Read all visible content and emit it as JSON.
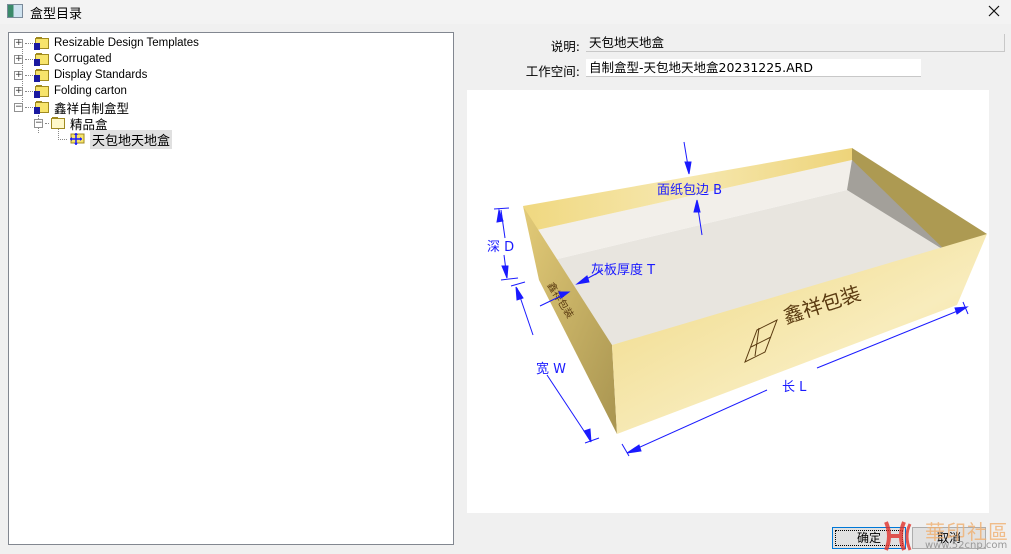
{
  "window": {
    "title": "盒型目录",
    "close_icon": "close-icon"
  },
  "tree": {
    "items": [
      {
        "label": "Resizable Design Templates",
        "expander": "+",
        "icon": "folder-icon"
      },
      {
        "label": "Corrugated",
        "expander": "+",
        "icon": "folder-icon"
      },
      {
        "label": "Display Standards",
        "expander": "+",
        "icon": "folder-icon"
      },
      {
        "label": "Folding carton",
        "expander": "+",
        "icon": "folder-icon"
      },
      {
        "label": "鑫祥自制盒型",
        "expander": "−",
        "icon": "folder-icon",
        "children": [
          {
            "label": "精品盒",
            "expander": "−",
            "icon": "folder-open-icon",
            "children": [
              {
                "label": "天包地天地盒",
                "icon": "resizable-design-icon",
                "selected": true
              }
            ]
          }
        ]
      }
    ]
  },
  "details": {
    "description_label": "说明:",
    "description_value": "天包地天地盒",
    "workspace_label": "工作空间:",
    "workspace_value": "自制盒型-天包地天地盒20231225.ARD"
  },
  "preview": {
    "dimension_labels": {
      "wrap_edge": "面纸包边 B",
      "depth": "深 D",
      "board_thickness": "灰板厚度 T",
      "width": "宽 W",
      "length": "长 L"
    },
    "box_print_text": "鑫祥包装",
    "colors": {
      "box_outer": "#f2dc8e",
      "box_dark_side": "#ad9a52",
      "box_inner_floor": "#e8e5df",
      "box_inner_wall": "#a3a09a",
      "dimension_blue": "#1a1aff",
      "print_brown": "#5a3a10"
    }
  },
  "buttons": {
    "ok_label": "确定",
    "cancel_label": "取消"
  },
  "watermark": {
    "text": "華印社區",
    "url": "www.52cnp.com"
  }
}
